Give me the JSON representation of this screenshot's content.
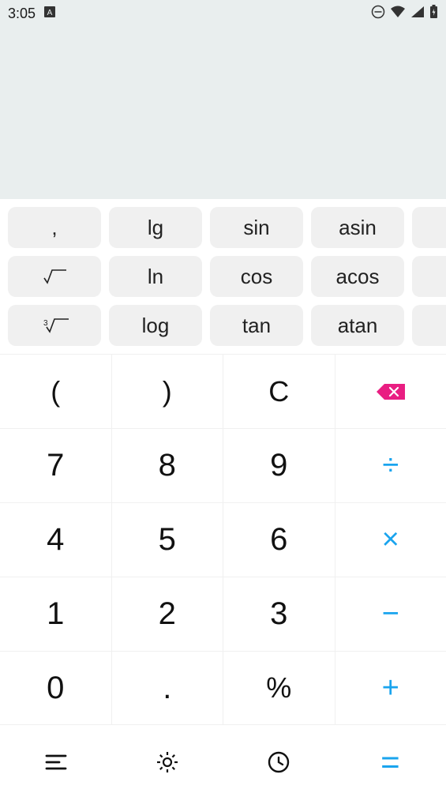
{
  "statusbar": {
    "time": "3:05"
  },
  "display": {
    "expression": ""
  },
  "fn": {
    "r0c0": ",",
    "r0c1": "lg",
    "r0c2": "sin",
    "r0c3": "asin",
    "r1c1": "ln",
    "r1c2": "cos",
    "r1c3": "acos",
    "r2c1": "log",
    "r2c2": "tan",
    "r2c3": "atan"
  },
  "keypad": {
    "lparen": "(",
    "rparen": ")",
    "clear": "C",
    "seven": "7",
    "eight": "8",
    "nine": "9",
    "four": "4",
    "five": "5",
    "six": "6",
    "one": "1",
    "two": "2",
    "three": "3",
    "zero": "0",
    "dot": ".",
    "percent": "%",
    "divide": "÷",
    "multiply": "×",
    "minus": "−",
    "plus": "+",
    "equals": "="
  }
}
